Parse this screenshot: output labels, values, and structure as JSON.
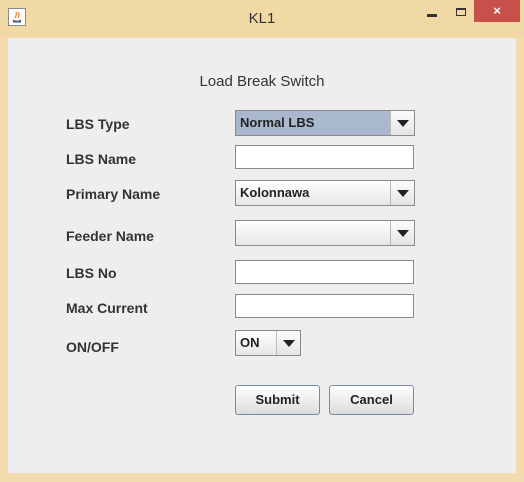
{
  "window": {
    "title": "KL1",
    "close_label": "×"
  },
  "form": {
    "heading": "Load Break Switch",
    "lbs_type": {
      "label": "LBS Type",
      "value": "Normal LBS"
    },
    "lbs_name": {
      "label": "LBS Name",
      "value": ""
    },
    "primary_name": {
      "label": "Primary Name",
      "value": "Kolonnawa"
    },
    "feeder_name": {
      "label": "Feeder Name",
      "value": ""
    },
    "lbs_no": {
      "label": "LBS No",
      "value": ""
    },
    "max_current": {
      "label": "Max Current",
      "value": ""
    },
    "on_off": {
      "label": "ON/OFF",
      "value": "ON"
    },
    "submit_label": "Submit",
    "cancel_label": "Cancel"
  }
}
